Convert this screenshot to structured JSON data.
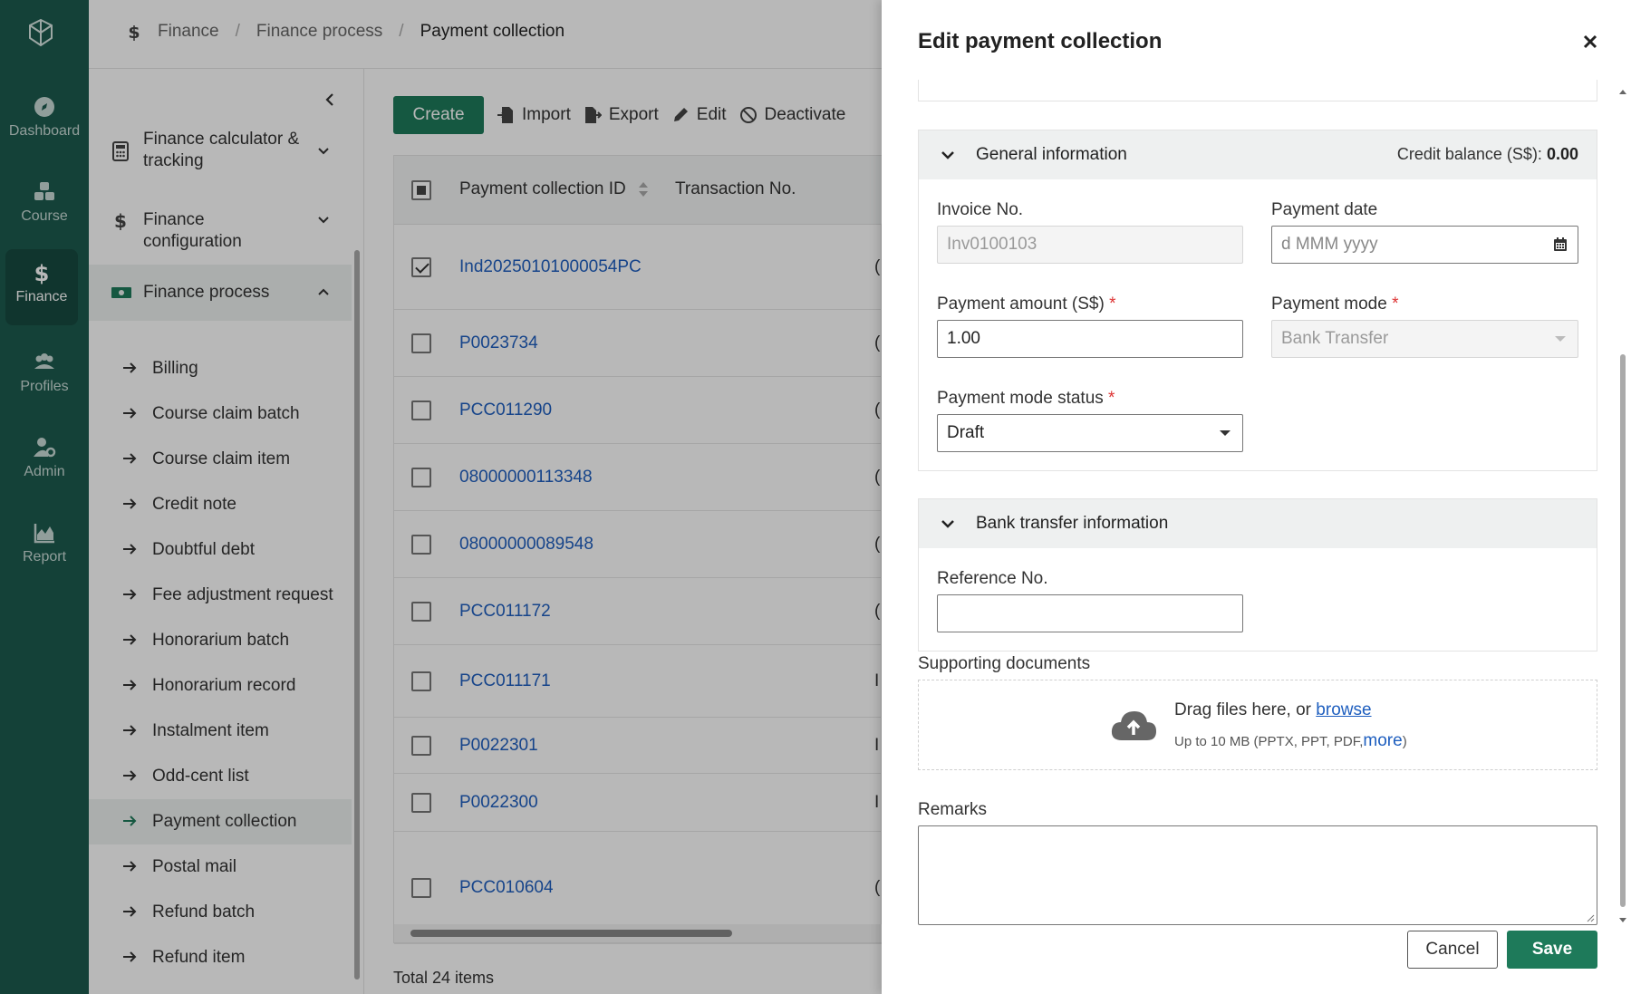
{
  "rail": {
    "items": [
      {
        "label": "Dashboard"
      },
      {
        "label": "Course"
      },
      {
        "label": "Finance"
      },
      {
        "label": "Profiles"
      },
      {
        "label": "Admin"
      },
      {
        "label": "Report"
      }
    ]
  },
  "breadcrumb": {
    "items": [
      "Finance",
      "Finance process",
      "Payment collection"
    ]
  },
  "subnav": {
    "groups": [
      {
        "label": "Finance calculator & tracking"
      },
      {
        "label": "Finance configuration"
      },
      {
        "label": "Finance process"
      }
    ],
    "items": [
      "Billing",
      "Course claim batch",
      "Course claim item",
      "Credit note",
      "Doubtful debt",
      "Fee adjustment request",
      "Honorarium batch",
      "Honorarium record",
      "Instalment item",
      "Odd-cent list",
      "Payment collection",
      "Postal mail",
      "Refund batch",
      "Refund item"
    ]
  },
  "toolbar": {
    "create": "Create",
    "import": "Import",
    "export": "Export",
    "edit": "Edit",
    "deactivate": "Deactivate"
  },
  "grid": {
    "columns": [
      "Payment collection ID",
      "Transaction No."
    ],
    "rows": [
      {
        "id": "Ind20250101000054PC",
        "t": "("
      },
      {
        "id": "P0023734",
        "t": "("
      },
      {
        "id": "PCC011290",
        "t": "("
      },
      {
        "id": "08000000113348",
        "t": "("
      },
      {
        "id": "08000000089548",
        "t": "("
      },
      {
        "id": "PCC011172",
        "t": "("
      },
      {
        "id": "PCC011171",
        "t": "I"
      },
      {
        "id": "P0022301",
        "t": "I"
      },
      {
        "id": "P0022300",
        "t": "I"
      },
      {
        "id": "PCC010604",
        "t": "("
      }
    ],
    "total": "Total 24 items"
  },
  "drawer": {
    "title": "Edit payment collection",
    "general": {
      "title": "General information",
      "credit_label": "Credit balance (S$):",
      "credit_value": "0.00",
      "invoice_label": "Invoice No.",
      "invoice_value": "Inv0100103",
      "payment_date_label": "Payment date",
      "payment_date_placeholder": "d MMM yyyy",
      "amount_label": "Payment amount (S$)",
      "amount_value": "1.00",
      "mode_label": "Payment mode",
      "mode_value": "Bank Transfer",
      "mode_status_label": "Payment mode status",
      "mode_status_value": "Draft"
    },
    "bank": {
      "title": "Bank transfer information",
      "reference_label": "Reference No.",
      "reference_value": ""
    },
    "documents": {
      "label": "Supporting documents",
      "drag_text": "Drag files here, or",
      "browse": "browse",
      "hint": "Up to 10 MB (PPTX, PPT, PDF,",
      "more": "more",
      "hint_end": ")"
    },
    "remarks_label": "Remarks",
    "cancel": "Cancel",
    "save": "Save"
  },
  "colors": {
    "rail": "#1d5a4e",
    "primary": "#1e7a5a",
    "link": "#1f5fbf",
    "required": "#dd3333"
  }
}
